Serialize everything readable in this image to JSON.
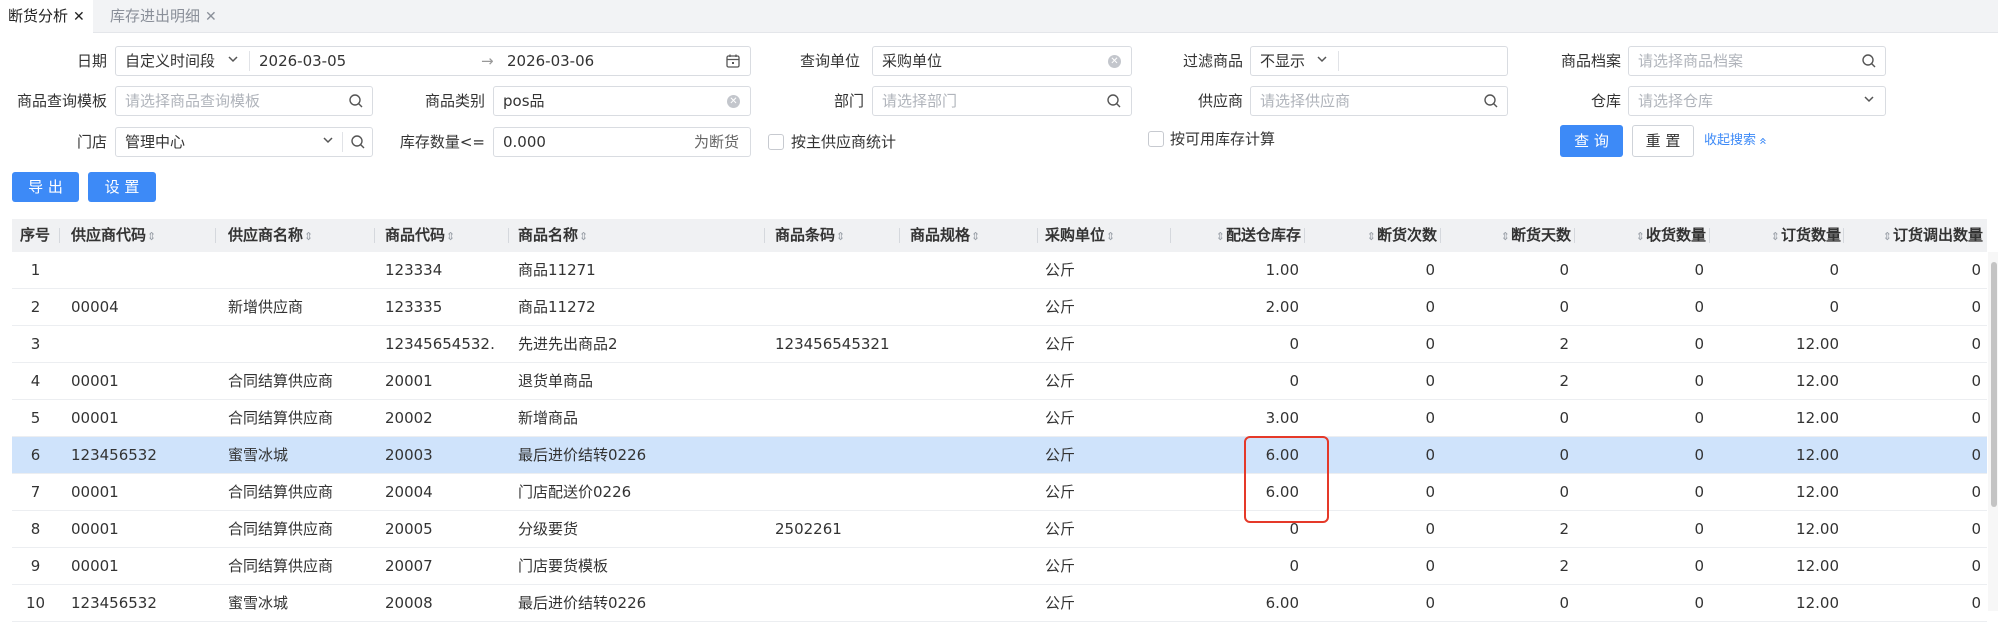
{
  "tabs": [
    {
      "label": "断货分析",
      "close": "✕"
    },
    {
      "label": "库存进出明细",
      "close": "✕"
    }
  ],
  "filters": {
    "date_label": "日期",
    "date_mode": "自定义时间段",
    "date_start": "2026-03-05",
    "date_arrow": "→",
    "date_end": "2026-03-06",
    "query_unit_label": "查询单位",
    "query_unit_value": "采购单位",
    "filter_goods_label": "过滤商品",
    "filter_goods_value": "不显示",
    "goods_archive_label": "商品档案",
    "goods_archive_placeholder": "请选择商品档案",
    "template_label": "商品查询模板",
    "template_placeholder": "请选择商品查询模板",
    "category_label": "商品类别",
    "category_value": "pos品",
    "dept_label": "部门",
    "dept_placeholder": "请选择部门",
    "supplier_label": "供应商",
    "supplier_placeholder": "请选择供应商",
    "warehouse_label": "仓库",
    "warehouse_placeholder": "请选择仓库",
    "store_label": "门店",
    "store_value": "管理中心",
    "stock_qty_label": "库存数量<=",
    "stock_qty_value": "0.000",
    "stock_qty_suffix": "为断货",
    "by_main_supplier_label": "按主供应商统计",
    "by_available_stock_label": "按可用库存计算",
    "query_button": "查 询",
    "reset_button": "重 置",
    "collapse_link": "收起搜索",
    "collapse_icon": "«"
  },
  "toolbar": {
    "export_button": "导 出",
    "settings_button": "设 置"
  },
  "table": {
    "columns": [
      "序号",
      "供应商代码",
      "供应商名称",
      "商品代码",
      "商品名称",
      "商品条码",
      "商品规格",
      "采购单位",
      "配送仓库存",
      "断货次数",
      "断货天数",
      "收货数量",
      "订货数量",
      "订货调出数量"
    ],
    "rows": [
      {
        "idx": "1",
        "supplier_code": "",
        "supplier_name": "",
        "goods_code": "123334",
        "goods_name": "商品11271",
        "barcode": "",
        "spec": "",
        "unit": "公斤",
        "stock": "1.00",
        "oos_times": "0",
        "oos_days": "0",
        "received": "0",
        "ordered": "0",
        "order_out": "0"
      },
      {
        "idx": "2",
        "supplier_code": "00004",
        "supplier_name": "新增供应商",
        "goods_code": "123335",
        "goods_name": "商品11272",
        "barcode": "",
        "spec": "",
        "unit": "公斤",
        "stock": "2.00",
        "oos_times": "0",
        "oos_days": "0",
        "received": "0",
        "ordered": "0",
        "order_out": "0"
      },
      {
        "idx": "3",
        "supplier_code": "",
        "supplier_name": "",
        "goods_code": "12345654532…",
        "goods_name": "先进先出商品2",
        "barcode": "123456545321",
        "spec": "",
        "unit": "公斤",
        "stock": "0",
        "oos_times": "0",
        "oos_days": "2",
        "received": "0",
        "ordered": "12.00",
        "order_out": "0"
      },
      {
        "idx": "4",
        "supplier_code": "00001",
        "supplier_name": "合同结算供应商",
        "goods_code": "20001",
        "goods_name": "退货单商品",
        "barcode": "",
        "spec": "",
        "unit": "公斤",
        "stock": "0",
        "oos_times": "0",
        "oos_days": "2",
        "received": "0",
        "ordered": "12.00",
        "order_out": "0"
      },
      {
        "idx": "5",
        "supplier_code": "00001",
        "supplier_name": "合同结算供应商",
        "goods_code": "20002",
        "goods_name": "新增商品",
        "barcode": "",
        "spec": "",
        "unit": "公斤",
        "stock": "3.00",
        "oos_times": "0",
        "oos_days": "0",
        "received": "0",
        "ordered": "12.00",
        "order_out": "0"
      },
      {
        "idx": "6",
        "supplier_code": "123456532",
        "supplier_name": "蜜雪冰城",
        "goods_code": "20003",
        "goods_name": "最后进价结转0226",
        "barcode": "",
        "spec": "",
        "unit": "公斤",
        "stock": "6.00",
        "oos_times": "0",
        "oos_days": "0",
        "received": "0",
        "ordered": "12.00",
        "order_out": "0"
      },
      {
        "idx": "7",
        "supplier_code": "00001",
        "supplier_name": "合同结算供应商",
        "goods_code": "20004",
        "goods_name": "门店配送价0226",
        "barcode": "",
        "spec": "",
        "unit": "公斤",
        "stock": "6.00",
        "oos_times": "0",
        "oos_days": "0",
        "received": "0",
        "ordered": "12.00",
        "order_out": "0"
      },
      {
        "idx": "8",
        "supplier_code": "00001",
        "supplier_name": "合同结算供应商",
        "goods_code": "20005",
        "goods_name": "分级要货",
        "barcode": "2502261",
        "spec": "",
        "unit": "公斤",
        "stock": "0",
        "oos_times": "0",
        "oos_days": "2",
        "received": "0",
        "ordered": "12.00",
        "order_out": "0"
      },
      {
        "idx": "9",
        "supplier_code": "00001",
        "supplier_name": "合同结算供应商",
        "goods_code": "20007",
        "goods_name": "门店要货模板",
        "barcode": "",
        "spec": "",
        "unit": "公斤",
        "stock": "0",
        "oos_times": "0",
        "oos_days": "2",
        "received": "0",
        "ordered": "12.00",
        "order_out": "0"
      },
      {
        "idx": "10",
        "supplier_code": "123456532",
        "supplier_name": "蜜雪冰城",
        "goods_code": "20008",
        "goods_name": "最后进价结转0226",
        "barcode": "",
        "spec": "",
        "unit": "公斤",
        "stock": "6.00",
        "oos_times": "0",
        "oos_days": "0",
        "received": "0",
        "ordered": "12.00",
        "order_out": "0"
      }
    ],
    "selected_row": "6"
  },
  "icons": {
    "calendar": "calendar-icon",
    "search": "search-icon",
    "clear": "clear-icon",
    "chevron_down": "chevron-down-icon",
    "sort": "sort-icon"
  },
  "colors": {
    "primary": "#3d8af7",
    "selected_row": "#cfe3fb",
    "highlight_box": "#e53929"
  }
}
